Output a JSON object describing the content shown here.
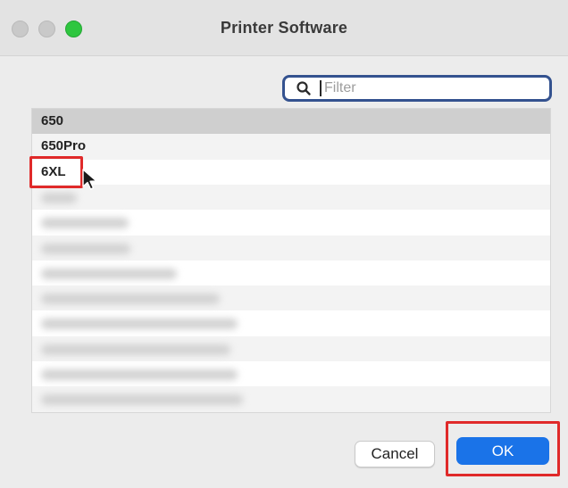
{
  "window": {
    "title": "Printer Software"
  },
  "search": {
    "placeholder": "Filter",
    "value": ""
  },
  "list": {
    "items": [
      {
        "label": "650",
        "state": "selected"
      },
      {
        "label": "650Pro"
      },
      {
        "label": "6XL",
        "highlighted": true
      }
    ]
  },
  "buttons": {
    "cancel_label": "Cancel",
    "ok_label": "OK"
  },
  "colors": {
    "accent": "#1a73e8",
    "highlight": "#e02a2a",
    "search_focus": "#34528f"
  }
}
